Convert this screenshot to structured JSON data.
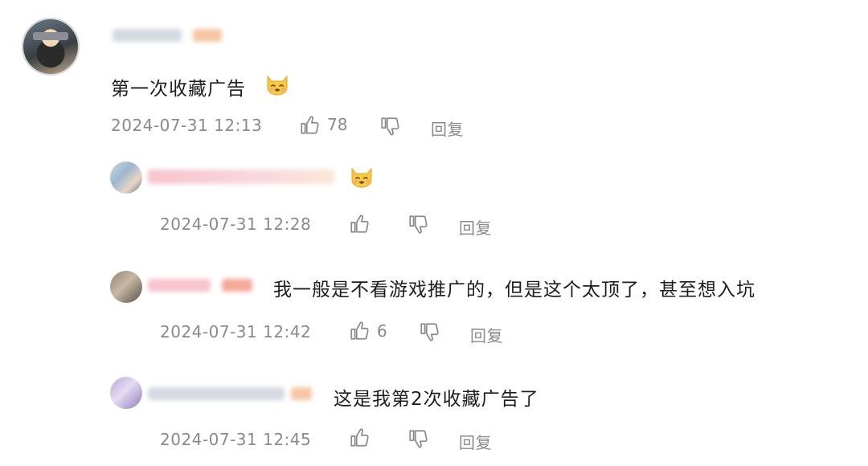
{
  "comments": [
    {
      "text": "第一次收藏广告",
      "timestamp": "2024-07-31 12:13",
      "like_count": "78",
      "reply_label": "回复",
      "emoji": "cat-face-emoji"
    },
    {
      "text": "",
      "timestamp": "2024-07-31 12:28",
      "like_count": "",
      "reply_label": "回复",
      "emoji": "cat-face-emoji"
    },
    {
      "text": "我一般是不看游戏推广的，但是这个太顶了，甚至想入坑",
      "timestamp": "2024-07-31 12:42",
      "like_count": "6",
      "reply_label": "回复"
    },
    {
      "text": "这是我第2次收藏广告了",
      "timestamp": "2024-07-31 12:45",
      "like_count": "",
      "reply_label": "回复"
    }
  ],
  "colors": {
    "meta_text": "#8a8a8e",
    "main_text": "#1d1d1f",
    "username_blur_pink": "#f7c3cf",
    "username_blur_gray": "#d4d9e2"
  }
}
